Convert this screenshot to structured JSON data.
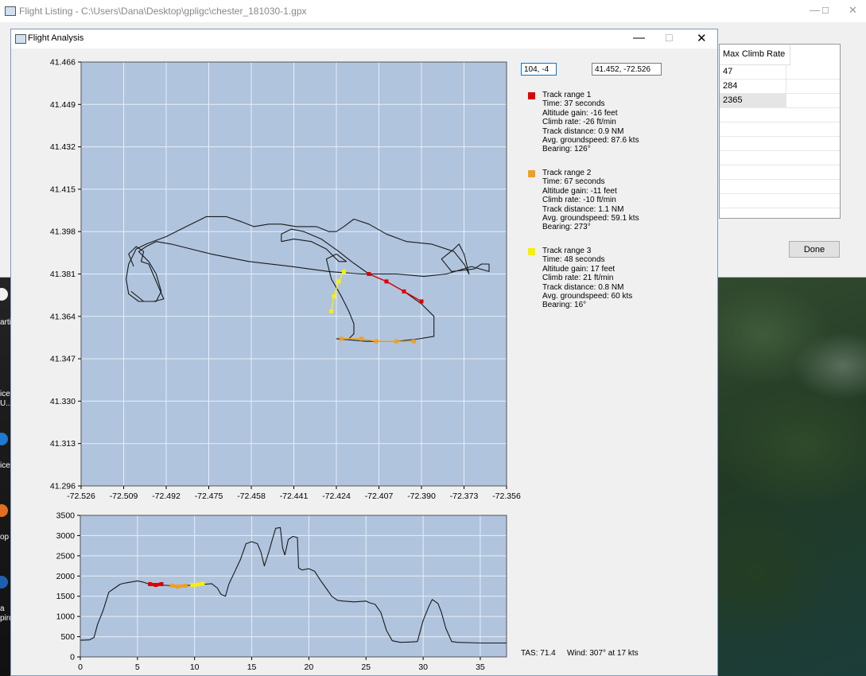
{
  "colors": {
    "plot_bg": "#b0c4de",
    "track": "#1a1a1a",
    "range1": "#e00000",
    "range2": "#f0a020",
    "range3": "#f8f000",
    "grid": "#e8eef6"
  },
  "listing_window": {
    "title": "Flight Listing - C:\\Users\\Dana\\Desktop\\gpligc\\chester_181030-1.gpx",
    "table_header": "Max Climb Rate",
    "rows": [
      "47",
      "284",
      "2365"
    ],
    "done_label": "Done"
  },
  "analysis_window": {
    "title": "Flight Analysis",
    "pixel_input": "104, -4",
    "latlon_input": "41.452, -72.526",
    "ranges": [
      {
        "title": "Track range 1",
        "lines": [
          "Time: 37 seconds",
          "Altitude gain: -16 feet",
          "Climb rate: -26 ft/min",
          "Track distance: 0.9 NM",
          "Avg. groundspeed: 87.6 kts",
          "Bearing: 126°"
        ]
      },
      {
        "title": "Track range 2",
        "lines": [
          "Time: 67 seconds",
          "Altitude gain: -11 feet",
          "Climb rate: -10 ft/min",
          "Track distance: 1.1 NM",
          "Avg. groundspeed: 59.1 kts",
          "Bearing: 273°"
        ]
      },
      {
        "title": "Track range 3",
        "lines": [
          "Time: 48 seconds",
          "Altitude gain: 17 feet",
          "Climb rate: 21 ft/min",
          "Track distance: 0.8 NM",
          "Avg. groundspeed: 60 kts",
          "Bearing: 16°"
        ]
      }
    ],
    "tas": "TAS: 71.4",
    "wind": "Wind: 307° at 17 kts"
  },
  "desktop": {
    "labels": [
      "arti",
      "ice",
      "U..",
      "ice",
      "op",
      "a",
      "pird"
    ]
  },
  "chart_data": [
    {
      "type": "line",
      "xlim": [
        -72.526,
        -72.356
      ],
      "ylim": [
        41.296,
        41.466
      ],
      "x_ticks": [
        "-72.526",
        "-72.509",
        "-72.492",
        "-72.475",
        "-72.458",
        "-72.441",
        "-72.424",
        "-72.407",
        "-72.390",
        "-72.373",
        "-72.356"
      ],
      "y_ticks": [
        "41.466",
        "41.449",
        "41.432",
        "41.415",
        "41.398",
        "41.381",
        "41.364",
        "41.347",
        "41.330",
        "41.313",
        "41.296"
      ],
      "grid": true,
      "series": [
        {
          "points": [
            [
              -72.505,
              41.384
            ],
            [
              -72.507,
              41.389
            ],
            [
              -72.504,
              41.392
            ],
            [
              -72.501,
              41.39
            ],
            [
              -72.502,
              41.386
            ],
            [
              -72.499,
              41.385
            ],
            [
              -72.496,
              41.378
            ],
            [
              -72.493,
              41.371
            ],
            [
              -72.497,
              41.37
            ],
            [
              -72.503,
              41.37
            ],
            [
              -72.507,
              41.373
            ],
            [
              -72.508,
              41.379
            ],
            [
              -72.507,
              41.385
            ],
            [
              -72.504,
              41.391
            ],
            [
              -72.5,
              41.393
            ],
            [
              -72.492,
              41.396
            ],
            [
              -72.484,
              41.4
            ],
            [
              -72.476,
              41.404
            ],
            [
              -72.468,
              41.404
            ],
            [
              -72.462,
              41.402
            ],
            [
              -72.457,
              41.4
            ],
            [
              -72.451,
              41.401
            ],
            [
              -72.446,
              41.401
            ],
            [
              -72.44,
              41.4
            ],
            [
              -72.432,
              41.4
            ],
            [
              -72.427,
              41.398
            ],
            [
              -72.424,
              41.398
            ],
            [
              -72.421,
              41.4
            ],
            [
              -72.417,
              41.403
            ],
            [
              -72.411,
              41.401
            ],
            [
              -72.404,
              41.397
            ],
            [
              -72.396,
              41.394
            ],
            [
              -72.386,
              41.393
            ],
            [
              -72.377,
              41.39
            ],
            [
              -72.373,
              41.385
            ],
            [
              -72.371,
              41.381
            ],
            [
              -72.373,
              41.389
            ],
            [
              -72.375,
              41.393
            ],
            [
              -72.377,
              41.391
            ],
            [
              -72.382,
              41.387
            ],
            [
              -72.378,
              41.382
            ],
            [
              -72.369,
              41.383
            ],
            [
              -72.366,
              41.385
            ],
            [
              -72.363,
              41.385
            ],
            [
              -72.363,
              41.382
            ],
            [
              -72.37,
              41.384
            ],
            [
              -72.38,
              41.381
            ],
            [
              -72.389,
              41.38
            ],
            [
              -72.4,
              41.381
            ],
            [
              -72.414,
              41.381
            ],
            [
              -72.427,
              41.382
            ],
            [
              -72.442,
              41.384
            ],
            [
              -72.459,
              41.386
            ],
            [
              -72.474,
              41.389
            ],
            [
              -72.49,
              41.393
            ],
            [
              -72.496,
              41.394
            ],
            [
              -72.5,
              41.392
            ],
            [
              -72.503,
              41.39
            ],
            [
              -72.499,
              41.386
            ],
            [
              -72.496,
              41.381
            ],
            [
              -72.494,
              41.374
            ],
            [
              -72.496,
              41.37
            ],
            [
              -72.501,
              41.37
            ],
            [
              -72.506,
              41.374
            ]
          ]
        },
        {
          "points": [
            [
              -72.446,
              41.394
            ],
            [
              -72.441,
              41.395
            ],
            [
              -72.434,
              41.394
            ],
            [
              -72.428,
              41.391
            ],
            [
              -72.423,
              41.386
            ],
            [
              -72.42,
              41.386
            ],
            [
              -72.424,
              41.389
            ],
            [
              -72.428,
              41.387
            ],
            [
              -72.426,
              41.379
            ],
            [
              -72.422,
              41.372
            ],
            [
              -72.419,
              41.366
            ],
            [
              -72.417,
              41.361
            ],
            [
              -72.417,
              41.357
            ],
            [
              -72.419,
              41.355
            ],
            [
              -72.424,
              41.355
            ],
            [
              -72.412,
              41.354
            ],
            [
              -72.4,
              41.354
            ],
            [
              -72.391,
              41.355
            ],
            [
              -72.385,
              41.356
            ],
            [
              -72.385,
              41.364
            ],
            [
              -72.39,
              41.369
            ],
            [
              -72.397,
              41.374
            ],
            [
              -72.404,
              41.378
            ],
            [
              -72.411,
              41.381
            ],
            [
              -72.418,
              41.386
            ],
            [
              -72.423,
              41.39
            ],
            [
              -72.43,
              41.395
            ],
            [
              -72.437,
              41.398
            ],
            [
              -72.442,
              41.399
            ],
            [
              -72.446,
              41.397
            ],
            [
              -72.446,
              41.394
            ]
          ]
        },
        {
          "name": "Track range 1",
          "points": [
            [
              -72.411,
              41.381
            ],
            [
              -72.404,
              41.378
            ],
            [
              -72.397,
              41.374
            ],
            [
              -72.39,
              41.37
            ]
          ]
        },
        {
          "name": "Track range 2",
          "points": [
            [
              -72.422,
              41.355
            ],
            [
              -72.414,
              41.355
            ],
            [
              -72.408,
              41.354
            ],
            [
              -72.4,
              41.354
            ],
            [
              -72.393,
              41.354
            ]
          ]
        },
        {
          "name": "Track range 3",
          "points": [
            [
              -72.426,
              41.366
            ],
            [
              -72.425,
              41.372
            ],
            [
              -72.423,
              41.378
            ],
            [
              -72.421,
              41.382
            ]
          ]
        }
      ]
    },
    {
      "type": "line",
      "xlim": [
        0,
        37.3
      ],
      "ylim": [
        0,
        3500
      ],
      "x_ticks": [
        "0",
        "5",
        "10",
        "15",
        "20",
        "25",
        "30",
        "35"
      ],
      "y_ticks": [
        "3500",
        "3000",
        "2500",
        "2000",
        "1500",
        "1000",
        "500",
        "0"
      ],
      "grid": true,
      "series": [
        {
          "points": [
            [
              0,
              410
            ],
            [
              0.8,
              420
            ],
            [
              1.2,
              480
            ],
            [
              1.5,
              800
            ],
            [
              2,
              1150
            ],
            [
              2.5,
              1600
            ],
            [
              3,
              1700
            ],
            [
              3.5,
              1800
            ],
            [
              4,
              1830
            ],
            [
              5,
              1880
            ],
            [
              5.5,
              1850
            ],
            [
              6,
              1800
            ],
            [
              7,
              1780
            ],
            [
              8,
              1760
            ],
            [
              8.5,
              1740
            ],
            [
              9,
              1750
            ],
            [
              9.5,
              1770
            ],
            [
              10,
              1780
            ],
            [
              11,
              1800
            ],
            [
              11.5,
              1810
            ],
            [
              12,
              1700
            ],
            [
              12.3,
              1550
            ],
            [
              12.7,
              1500
            ],
            [
              13,
              1800
            ],
            [
              13.5,
              2100
            ],
            [
              14,
              2400
            ],
            [
              14.5,
              2800
            ],
            [
              15,
              2850
            ],
            [
              15.5,
              2800
            ],
            [
              15.8,
              2600
            ],
            [
              16.1,
              2250
            ],
            [
              16.5,
              2600
            ],
            [
              16.8,
              2900
            ],
            [
              17.1,
              3180
            ],
            [
              17.5,
              3200
            ],
            [
              17.7,
              2700
            ],
            [
              17.9,
              2520
            ],
            [
              18.2,
              2900
            ],
            [
              18.6,
              2980
            ],
            [
              19,
              2950
            ],
            [
              19.1,
              2200
            ],
            [
              19.4,
              2150
            ],
            [
              20,
              2180
            ],
            [
              20.5,
              2120
            ],
            [
              21,
              1900
            ],
            [
              21.5,
              1700
            ],
            [
              22,
              1500
            ],
            [
              22.5,
              1400
            ],
            [
              23,
              1380
            ],
            [
              24,
              1360
            ],
            [
              25,
              1380
            ],
            [
              25.3,
              1340
            ],
            [
              25.8,
              1300
            ],
            [
              26.3,
              1100
            ],
            [
              26.8,
              650
            ],
            [
              27.3,
              400
            ],
            [
              28,
              360
            ],
            [
              29,
              370
            ],
            [
              29.5,
              380
            ],
            [
              30,
              900
            ],
            [
              30.5,
              1250
            ],
            [
              30.8,
              1420
            ],
            [
              31.3,
              1320
            ],
            [
              31.6,
              1100
            ],
            [
              32,
              700
            ],
            [
              32.5,
              380
            ],
            [
              33,
              360
            ],
            [
              35,
              345
            ],
            [
              37.3,
              345
            ]
          ]
        },
        {
          "name": "Track range 1",
          "points": [
            [
              6.1,
              1800
            ],
            [
              6.6,
              1780
            ],
            [
              7.1,
              1800
            ]
          ]
        },
        {
          "name": "Track range 2",
          "points": [
            [
              8.0,
              1760
            ],
            [
              8.5,
              1740
            ],
            [
              9.2,
              1760
            ]
          ]
        },
        {
          "name": "Track range 3",
          "points": [
            [
              9.8,
              1780
            ],
            [
              10.3,
              1790
            ],
            [
              10.7,
              1810
            ]
          ]
        }
      ]
    }
  ]
}
